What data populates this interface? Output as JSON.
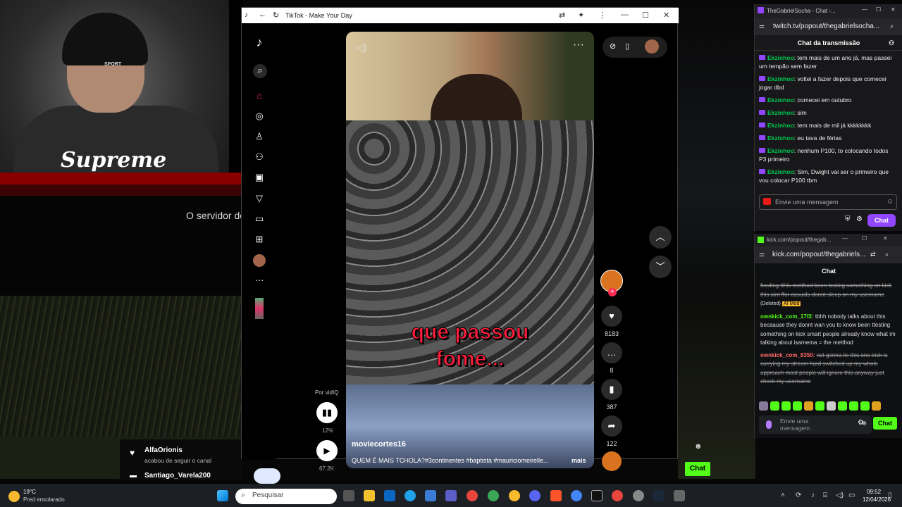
{
  "background": {
    "server_text": "O servidor de",
    "webcam_shirt_text": "Supreme",
    "beanie_label": "SPORT"
  },
  "tiktok": {
    "title": "TikTok - Make Your Day",
    "video": {
      "caption_line1": "que passou",
      "caption_line2": "fome...",
      "username": "moviecortes16",
      "description": "QUEM É MAIS TCHOLA?#3continentes #baptista #mauriciomeirelle...",
      "more": "mais"
    },
    "actions": {
      "likes": "8183",
      "comments": "8",
      "saves": "387",
      "shares": "122"
    },
    "vidiq": {
      "label": "Por vidIQ",
      "percent": "12%",
      "views": "67.2K"
    }
  },
  "twitch": {
    "tab_title": "TheGabrielSocha - Chat -...",
    "url": "twitch.tv/popout/thegabrielsocha...",
    "header": "Chat da transmissão",
    "messages": [
      {
        "user": "Ekzinhoo",
        "text": "tem mais de um ano já, mas passei um tempão sem fazer"
      },
      {
        "user": "Ekzinhoo",
        "text": "voltei a fazer depois que comecei jogar dbd"
      },
      {
        "user": "Ekzinhoo",
        "text": "comecei em outubro"
      },
      {
        "user": "Ekzinhoo",
        "text": "sim"
      },
      {
        "user": "Ekzinhoo",
        "text": "tem mais de mil já kkkkkkkk"
      },
      {
        "user": "Ekzinhoo",
        "text": "eu tava de férias"
      },
      {
        "user": "Ekzinhoo",
        "text": "nenhum P100, to colocando todos P3 primeiro"
      },
      {
        "user": "Ekzinhoo",
        "text": "Sim, Dwight vai ser o primeiro que vou colocar P100 tbm"
      }
    ],
    "input_placeholder": "Envie uma mensagem",
    "chat_button": "Chat"
  },
  "kick": {
    "tab_title": "kick.com/popout/thegab...",
    "url": "kick.com/popout/thegabriels...",
    "header": "Chat",
    "messages": [
      {
        "user": "",
        "text": "feeding tthis metthod been testing something on kick this aint ffor casuals donnt sleep on my username",
        "suffix": "(Deleted)",
        "tag": "AI Mod"
      },
      {
        "user": "ownkick_com_17f2:",
        "text": "tbhh nobody talks about this becaause they donnt wan you to know been ttesting something on kick smart people already know what im talking about isarnema = the metthod"
      },
      {
        "user": "ownkick_com_8350:",
        "text": "not gonna lie this one trick is carrying my stream hard switched up my whole approach most people will ignore this anyway just check my username"
      }
    ],
    "input_placeholder": "Envie uma mensagem",
    "chat_button": "Chat"
  },
  "overlay": {
    "follow1_name": "AlfaOrionis",
    "follow1_text": "acabou de seguir o canal",
    "follow2_name": "Santiago_Varela200",
    "chat_button": "Chat"
  },
  "taskbar": {
    "temperature": "19°C",
    "weather": "Pred ensolarado",
    "search_placeholder": "Pesquisar",
    "time": "09:52",
    "date": "12/04/2026"
  }
}
